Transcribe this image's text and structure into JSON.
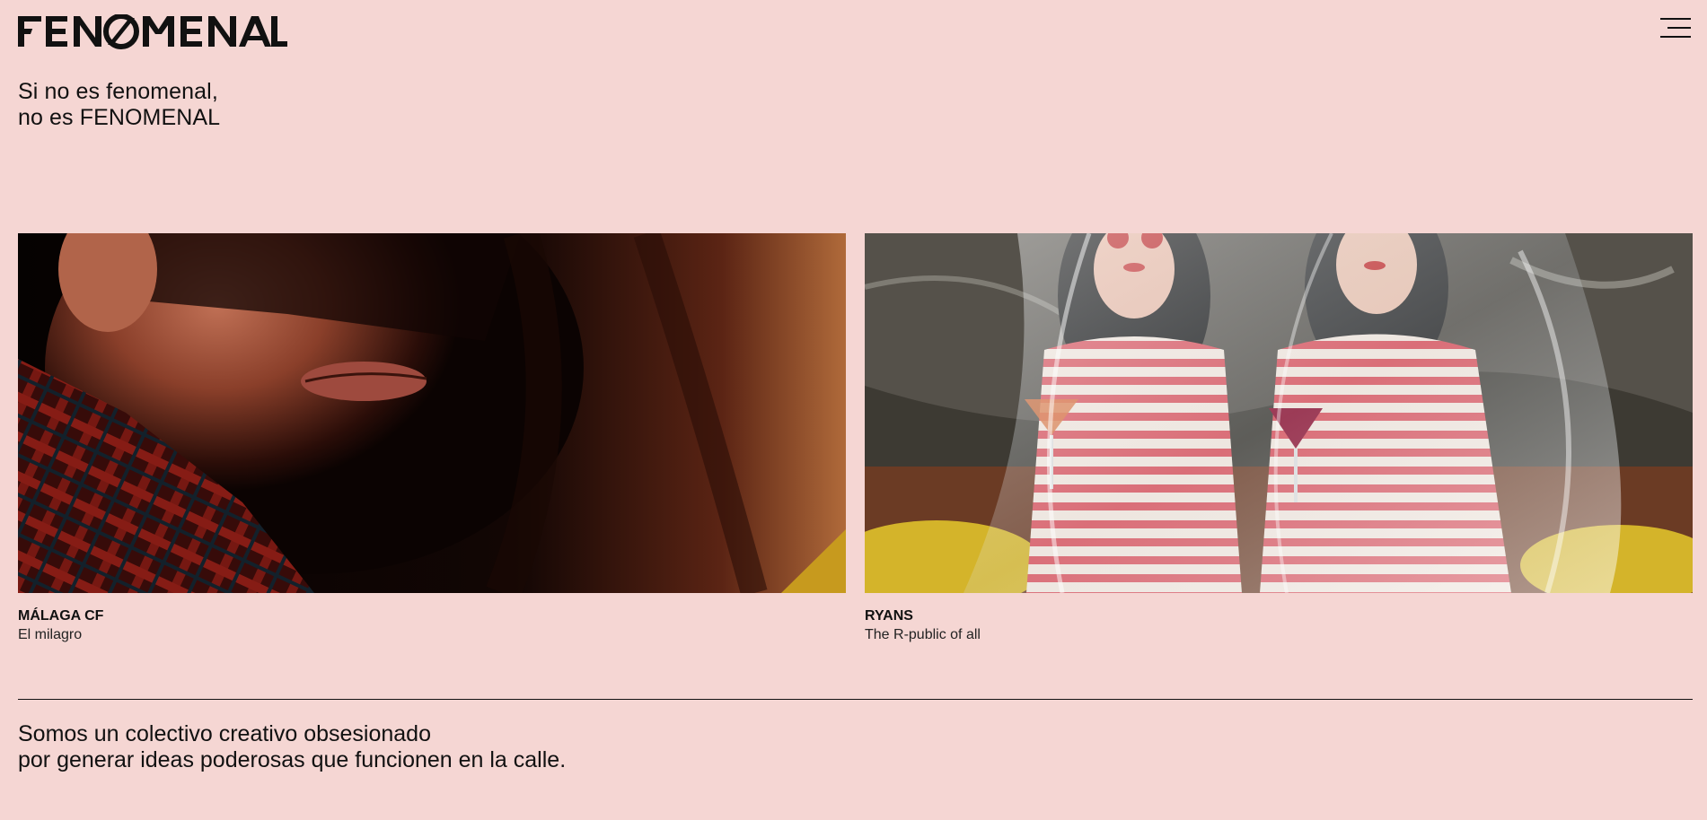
{
  "brand": {
    "logo_text": "FENOMENAL"
  },
  "header": {
    "menu_icon": "hamburger-menu-icon",
    "tagline_line1": "Si no es fenomenal,",
    "tagline_line2": "no es FENOMENAL"
  },
  "projects": [
    {
      "client": "MÁLAGA CF",
      "title": "El milagro",
      "image": "close-up-face-plaid-shirt-photo"
    },
    {
      "client": "RYANS",
      "title": "The R-public of all",
      "image": "two-women-striped-shirts-plastic-sheet-photo"
    }
  ],
  "about": {
    "line1": "Somos un colectivo creativo obsesionado",
    "line2": "por generar ideas poderosas que funcionen en la calle."
  },
  "colors": {
    "background": "#f5d6d3",
    "text": "#111111"
  }
}
